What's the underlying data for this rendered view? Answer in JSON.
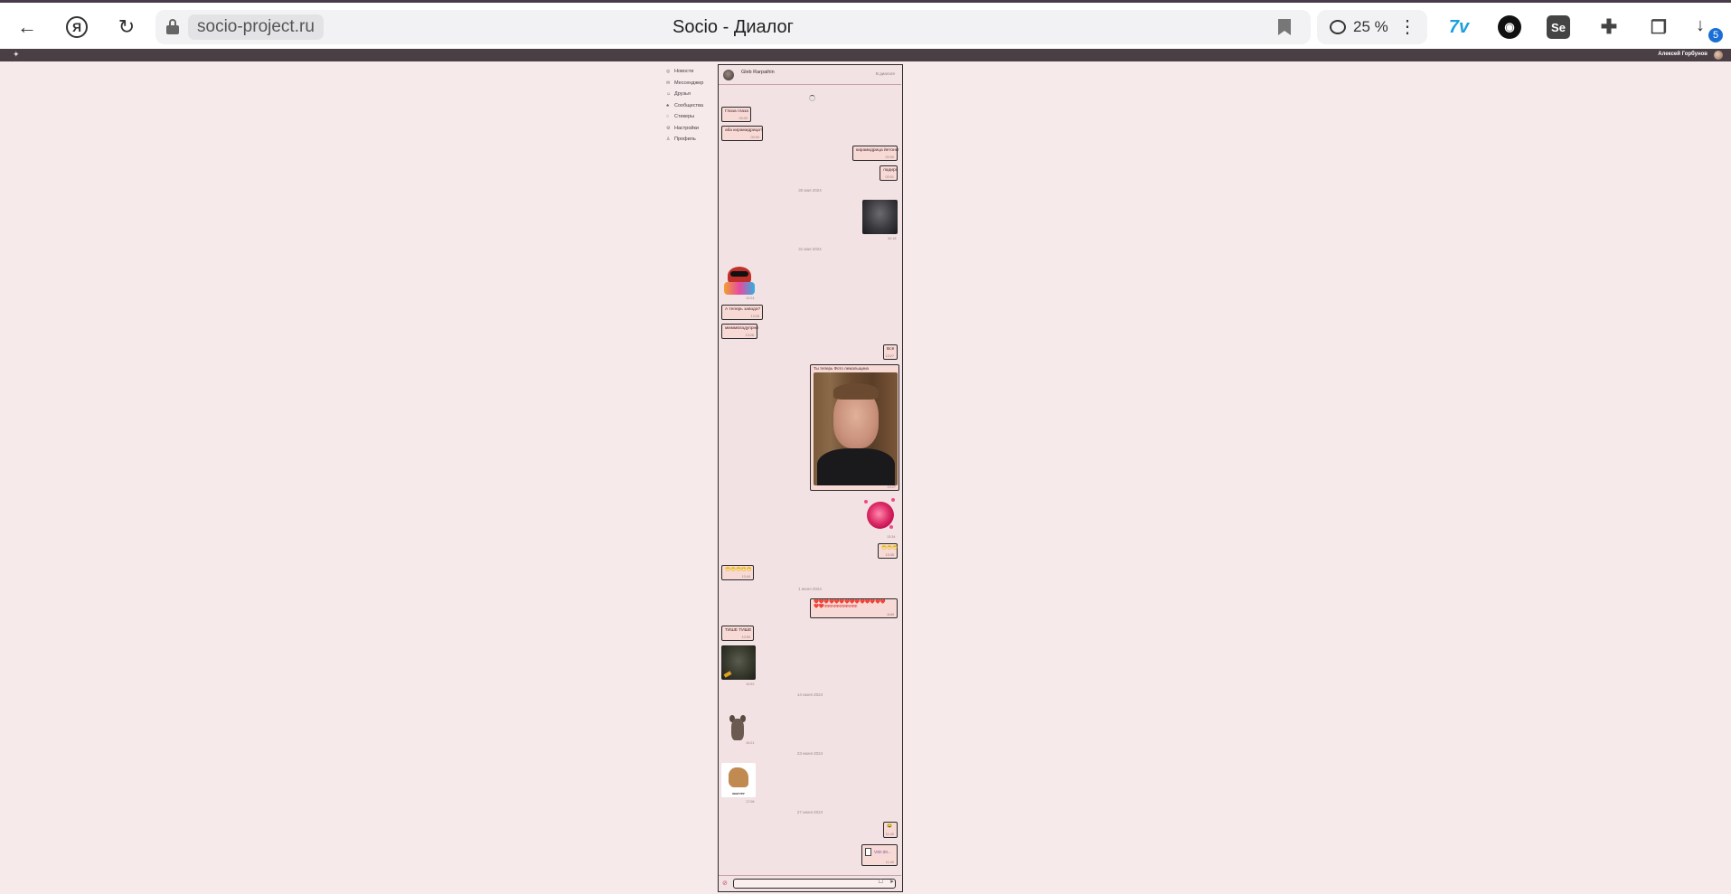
{
  "browser": {
    "domain": "socio-project.ru",
    "page_title": "Socio - Диалог",
    "zoom": "25 %",
    "downloads_badge": "5",
    "icons": [
      "back-arrow-icon",
      "yandex-icon",
      "reload-icon",
      "lock-icon",
      "bookmark-icon",
      "zoom-icon",
      "more-icon",
      "extension-icons",
      "download-icon"
    ]
  },
  "site": {
    "user_name": "Алексей Горбунов"
  },
  "nav": {
    "items": [
      {
        "label": "Новости",
        "icon": "news-icon"
      },
      {
        "label": "Мессенджер",
        "icon": "messenger-icon"
      },
      {
        "label": "Друзья",
        "icon": "friends-icon"
      },
      {
        "label": "Сообщества",
        "icon": "communities-icon"
      },
      {
        "label": "Стикеры",
        "icon": "stickers-icon"
      },
      {
        "label": "Настройки",
        "icon": "settings-icon"
      },
      {
        "label": "Профиль",
        "icon": "profile-icon"
      }
    ]
  },
  "dialog": {
    "contact_name": "Gleb Rarpaihin",
    "contact_status": "В диалоге",
    "composer_placeholder": "",
    "messages": [
      {
        "id": "m1",
        "side": "left",
        "text": "Глаза глаза",
        "time": "00:00"
      },
      {
        "id": "m2",
        "side": "left",
        "text": "аба кирамидрица?",
        "time": "00:00"
      },
      {
        "id": "m3",
        "side": "right",
        "text": "кирамидрица йетоньг",
        "time": "00:00"
      },
      {
        "id": "m4",
        "side": "right",
        "text": "ладира",
        "time": "00:01"
      },
      {
        "id": "d1",
        "date": "30 мая 2024"
      },
      {
        "id": "p1",
        "side": "right",
        "type": "photo",
        "time": "00:18"
      },
      {
        "id": "d2",
        "date": "31 мая 2024"
      },
      {
        "id": "s1",
        "side": "left",
        "type": "sticker",
        "time": "13:24"
      },
      {
        "id": "m5",
        "side": "left",
        "text": "А теперь завода?",
        "time": "13:26"
      },
      {
        "id": "m6",
        "side": "left",
        "text": "ммммвладупрни",
        "time": "13:26"
      },
      {
        "id": "m7",
        "side": "right",
        "text": "Всё",
        "time": "13:27"
      },
      {
        "id": "p2",
        "side": "right",
        "type": "photo",
        "caption": "Ты теперь Фото лежальщина",
        "time": "13:27"
      },
      {
        "id": "s2",
        "side": "right",
        "type": "sticker",
        "time": "13:34"
      },
      {
        "id": "m8",
        "side": "right",
        "text": "😁😁😁",
        "time": "13:35"
      },
      {
        "id": "m9",
        "side": "left",
        "text": "😁😁😁😁😁",
        "time": "13:44"
      },
      {
        "id": "d3",
        "date": "1 июня 2024"
      },
      {
        "id": "m10",
        "side": "right",
        "text": "❤️❤️❤️❤️❤️❤️❤️❤️❤️❤️❤️❤️❤️❤️",
        "text2": "❤️❤️ФФФФФФФФФФФ",
        "time": "10:49"
      },
      {
        "id": "m11",
        "side": "left",
        "text": "ТИШЕ ТИШЕ",
        "time": "10:50"
      },
      {
        "id": "p3",
        "side": "left",
        "type": "photo",
        "time": "10:52"
      },
      {
        "id": "d4",
        "date": "14 июня 2024"
      },
      {
        "id": "s3",
        "side": "left",
        "type": "sticker",
        "time": "19:21"
      },
      {
        "id": "d5",
        "date": "23 июня 2024"
      },
      {
        "id": "s4",
        "side": "left",
        "type": "sticker",
        "caption": "КЕНГУРУ",
        "time": "17:08"
      },
      {
        "id": "d6",
        "date": "27 июня 2024"
      },
      {
        "id": "m12",
        "side": "right",
        "text": "😂",
        "time": "11:40"
      },
      {
        "id": "f1",
        "side": "right",
        "type": "file",
        "text": "VID-20...",
        "time": "11:40"
      }
    ]
  }
}
